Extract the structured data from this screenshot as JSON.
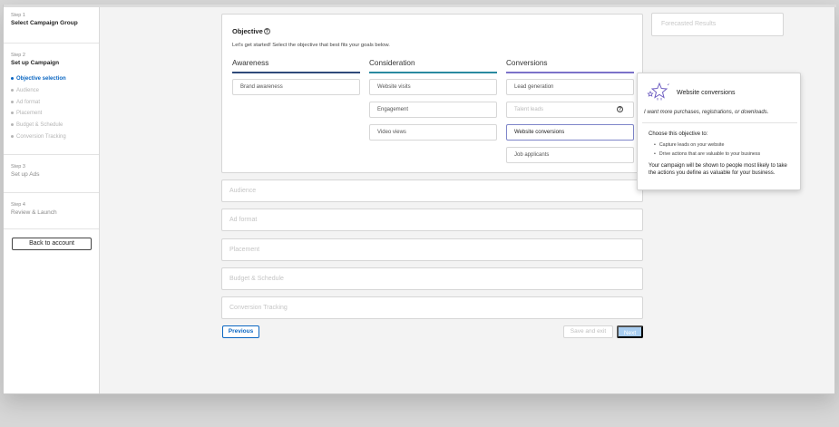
{
  "sidebar": {
    "step1": {
      "step": "Step 1",
      "name": "Select Campaign Group"
    },
    "step2": {
      "step": "Step 2",
      "name": "Set up Campaign",
      "items": [
        "Objective selection",
        "Audience",
        "Ad format",
        "Placement",
        "Budget & Schedule",
        "Conversion Tracking"
      ],
      "active_index": 0
    },
    "step3": {
      "step": "Step 3",
      "name": "Set up Ads"
    },
    "step4": {
      "step": "Step 4",
      "name": "Review & Launch"
    },
    "back_button": "Back to account"
  },
  "objective": {
    "title": "Objective",
    "help_icon": "?",
    "intro": "Let's get started! Select the objective that best fits your goals below.",
    "columns": [
      {
        "heading": "Awareness",
        "color": "#2f4a7a",
        "options": [
          "Brand awareness"
        ]
      },
      {
        "heading": "Consideration",
        "color": "#2a8aa0",
        "options": [
          "Website visits",
          "Engagement",
          "Video views"
        ]
      },
      {
        "heading": "Conversions",
        "color": "#7b72c9",
        "options": [
          "Lead generation",
          "Talent leads",
          "Website conversions",
          "Job applicants"
        ]
      }
    ],
    "selected_option": "Website conversions",
    "disabled_option": "Talent leads"
  },
  "sections": [
    "Audience",
    "Ad format",
    "Placement",
    "Budget & Schedule",
    "Conversion Tracking"
  ],
  "footer": {
    "previous": "Previous",
    "save_exit": "Save and exit",
    "next": "Next"
  },
  "forecast": {
    "label": "Forecasted Results"
  },
  "popover": {
    "icon": "sparkle-stars-icon",
    "title": "Website conversions",
    "quote": "I want more purchases, registrations, or downloads.",
    "choose": "Choose this objective to:",
    "bullets": [
      "Capture leads on your website",
      "Drive actions that are valuable to your business"
    ],
    "note": "Your campaign will be shown to people most likely to take the actions you define as valuable for your business."
  }
}
